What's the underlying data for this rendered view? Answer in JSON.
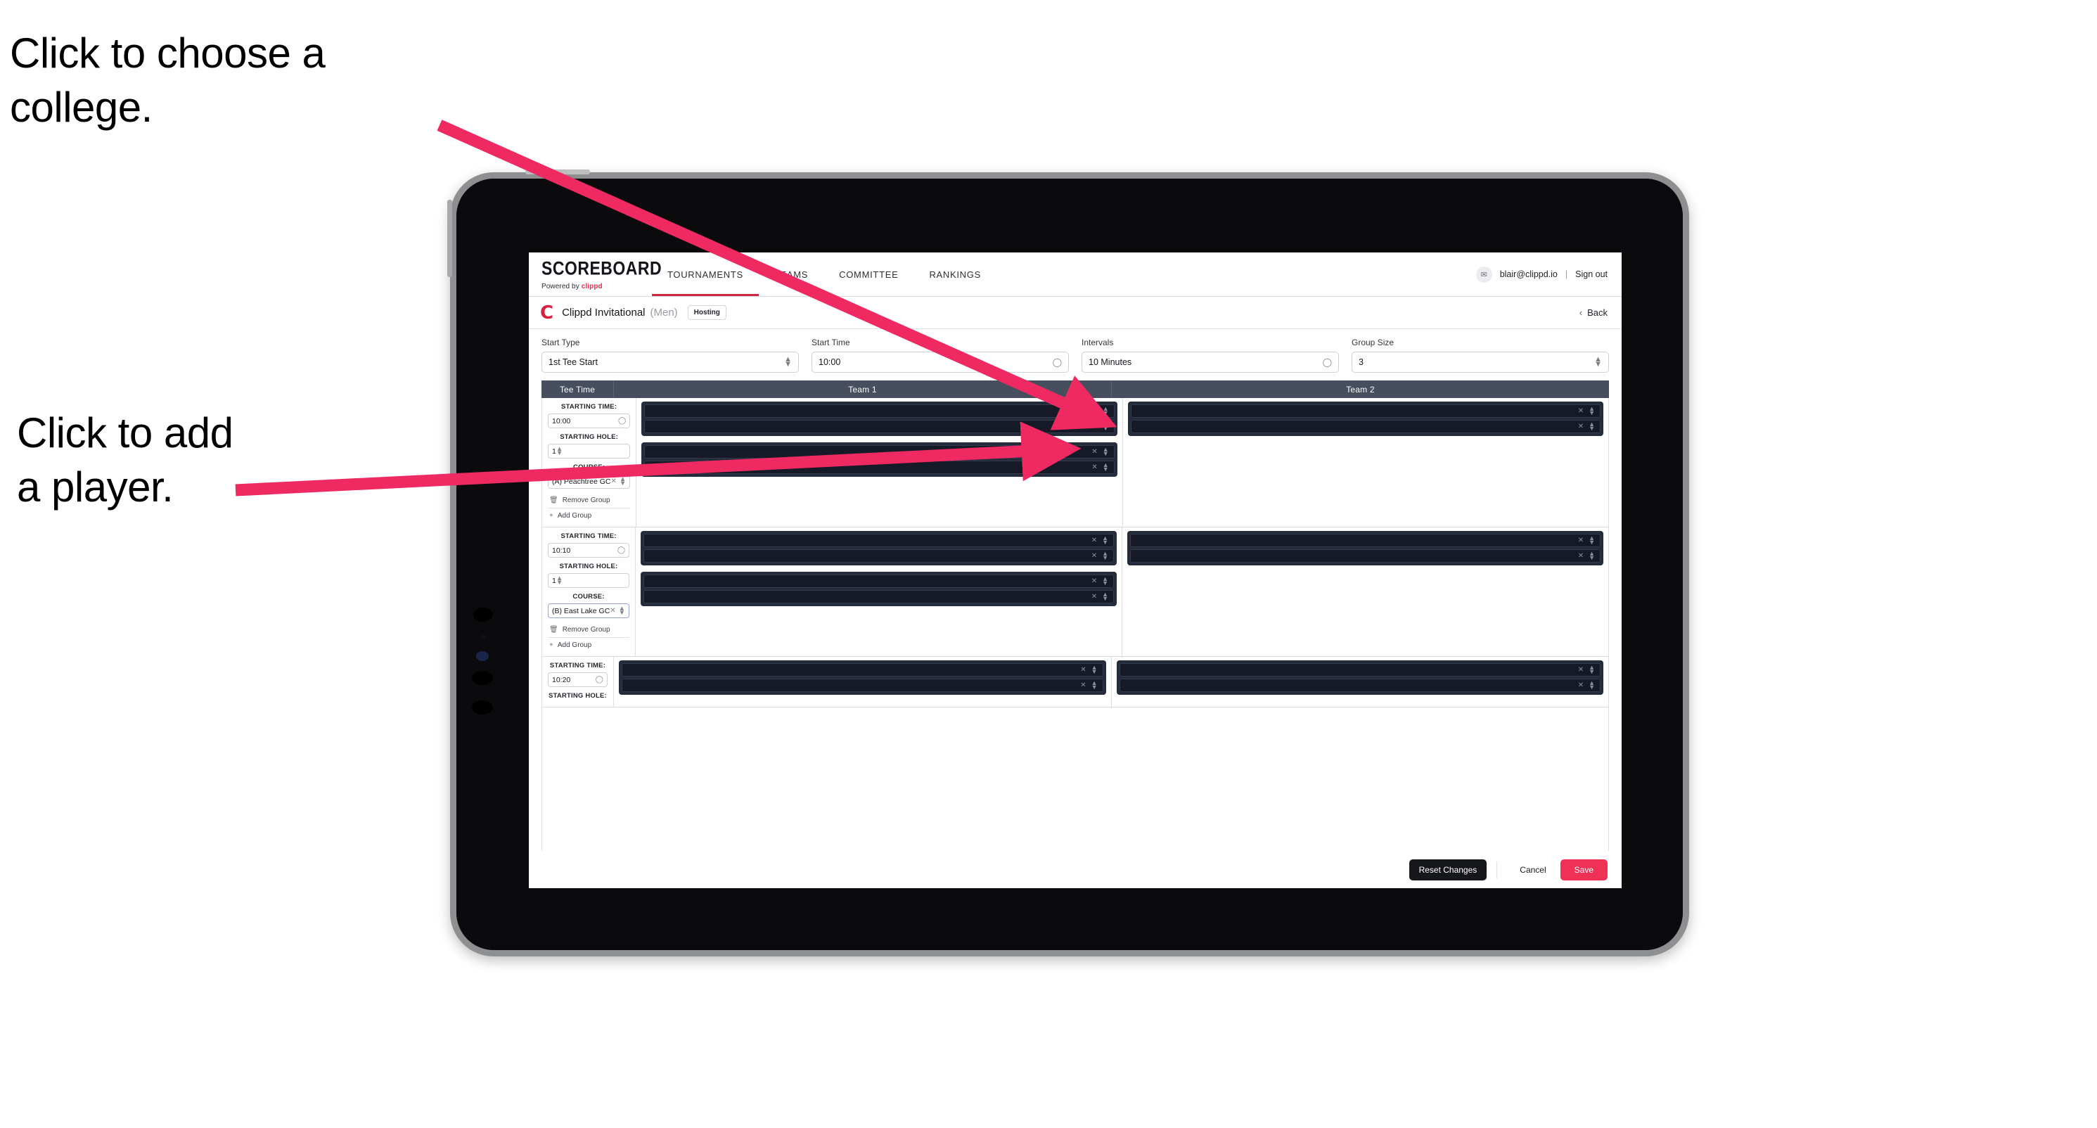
{
  "annotations": [
    {
      "id": "choose-college",
      "text": "Click to choose a\ncollege."
    },
    {
      "id": "add-player",
      "text": "Click to add\na player."
    }
  ],
  "colors": {
    "accent_red": "#ef3155",
    "brand_red": "#d8203f",
    "arrow_pink": "#ef2a63",
    "table_header": "#474e5e",
    "card_dark": "#242b3a",
    "slot_dark": "#151a26"
  },
  "topnav": {
    "brand_title": "SCOREBOARD",
    "brand_sub_prefix": "Powered by",
    "brand_sub_word": "clippd",
    "tabs": [
      {
        "label": "TOURNAMENTS",
        "active": true
      },
      {
        "label": "TEAMS",
        "active": false
      },
      {
        "label": "COMMITTEE",
        "active": false
      },
      {
        "label": "RANKINGS",
        "active": false
      }
    ],
    "avatar_glyph": "✉",
    "email": "blair@clippd.io",
    "separator": "|",
    "signout_label": "Sign out"
  },
  "tournament_bar": {
    "logo_letter": "C",
    "name": "Clippd Invitational",
    "gender": "(Men)",
    "badge": "Hosting",
    "back_chevron": "‹",
    "back_label": "Back"
  },
  "settings": [
    {
      "label": "Start Type",
      "value": "1st Tee Start",
      "control": "stepper",
      "icon": "chevron-updown-icon"
    },
    {
      "label": "Start Time",
      "value": "10:00",
      "control": "clock",
      "icon": "clock-icon"
    },
    {
      "label": "Intervals",
      "value": "10 Minutes",
      "control": "clock",
      "icon": "clock-icon"
    },
    {
      "label": "Group Size",
      "value": "3",
      "control": "stepper",
      "icon": "chevron-updown-icon"
    }
  ],
  "table": {
    "headers": [
      "Tee Time",
      "Team 1",
      "Team 2"
    ],
    "labels": {
      "starting_time": "STARTING TIME:",
      "starting_hole": "STARTING HOLE:",
      "course": "COURSE:",
      "remove_group": "Remove Group",
      "add_group": "Add Group",
      "remove_icon": "trash-icon",
      "add_icon": "plus-icon",
      "clock_icon": "clock-icon",
      "clear_icon": "close-icon",
      "stepper_icon": "chevron-updown-icon"
    },
    "rows": [
      {
        "starting_time": "10:00",
        "starting_hole": "1",
        "course": "(A) Peachtree GC",
        "course_focused": false,
        "team1_groups": [
          {
            "players": [
              "",
              ""
            ]
          },
          {
            "players": [
              "",
              ""
            ]
          }
        ],
        "team2_groups": [
          {
            "players": [
              "",
              ""
            ]
          }
        ]
      },
      {
        "starting_time": "10:10",
        "starting_hole": "1",
        "course": "(B) East Lake GC",
        "course_focused": true,
        "team1_groups": [
          {
            "players": [
              "",
              ""
            ]
          },
          {
            "players": [
              "",
              ""
            ]
          }
        ],
        "team2_groups": [
          {
            "players": [
              "",
              ""
            ]
          }
        ]
      },
      {
        "starting_time": "10:20",
        "starting_hole": "",
        "course": "",
        "course_focused": false,
        "team1_groups": [
          {
            "players": [
              "",
              ""
            ]
          }
        ],
        "team2_groups": [
          {
            "players": [
              "",
              ""
            ]
          }
        ]
      }
    ]
  },
  "footer": {
    "reset_label": "Reset Changes",
    "cancel_label": "Cancel",
    "save_label": "Save"
  }
}
